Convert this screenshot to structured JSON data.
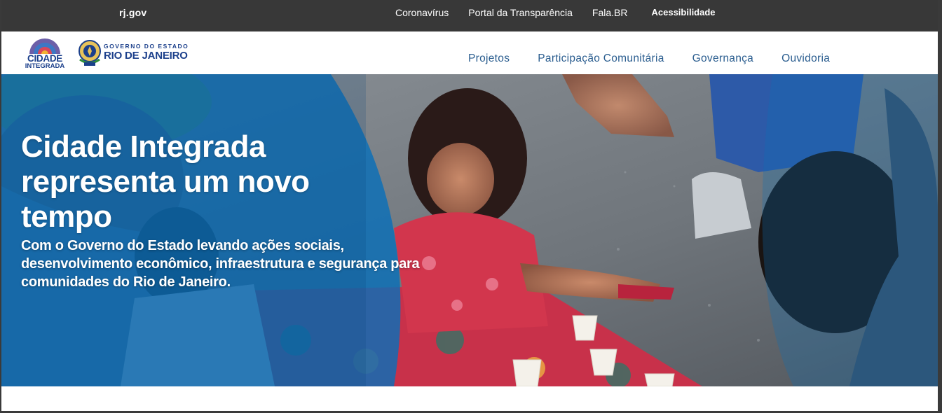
{
  "gov_bar": {
    "brand": "rj.gov",
    "links": [
      "Coronavírus",
      "Portal da Transparência",
      "Fala.BR"
    ],
    "accessibility": "Acessibilidade"
  },
  "header": {
    "logo_ci": {
      "line1": "CIDADE",
      "line2": "INTEGRADA"
    },
    "logo_rj": {
      "line1": "GOVERNO DO ESTADO",
      "line2": "RIO DE JANEIRO"
    },
    "nav": [
      "Projetos",
      "Participação Comunitária",
      "Governança",
      "Ouvidoria"
    ]
  },
  "hero": {
    "title": "Cidade Integrada representa um novo tempo",
    "subtitle": "Com o Governo do Estado levando ações sociais, desenvolvimento econômico, infraestrutura e segurança para comunidades do Rio de Janeiro."
  },
  "colors": {
    "gov_bar_bg": "#383838",
    "brand_blue": "#1b3f8b",
    "nav_blue": "#2a5d8f",
    "hero_overlay_blue": "#0a6fb8"
  }
}
